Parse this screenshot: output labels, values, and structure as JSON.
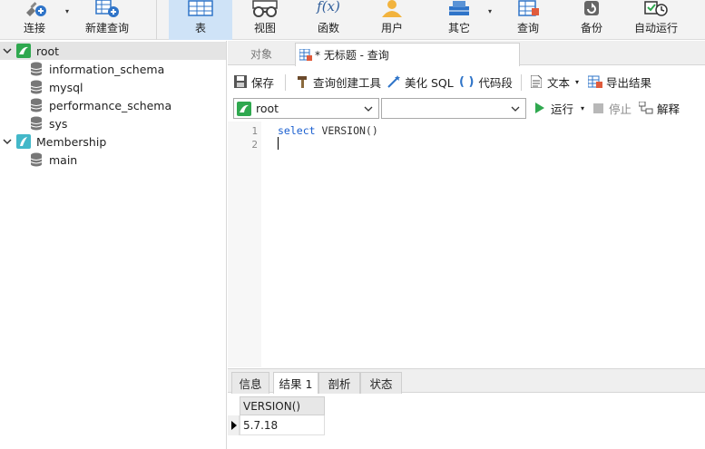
{
  "toolbar": {
    "connect": "连接",
    "new_query": "新建查询",
    "table": "表",
    "view": "视图",
    "function": "函数",
    "function_glyph": "f(x)",
    "user": "用户",
    "other": "其它",
    "query": "查询",
    "backup": "备份",
    "auto_run": "自动运行"
  },
  "sidebar": {
    "connections": [
      {
        "name": "root",
        "databases": [
          "information_schema",
          "mysql",
          "performance_schema",
          "sys"
        ]
      },
      {
        "name": "Membership",
        "databases": [
          "main"
        ]
      }
    ]
  },
  "tabs": {
    "objects": "对象",
    "query_tab": "* 无标题 - 查询"
  },
  "query_toolbar": {
    "save": "保存",
    "query_builder": "查询创建工具",
    "beautify": "美化 SQL",
    "code_snippet": "代码段",
    "code_snippet_glyph": "( )",
    "text": "文本",
    "export": "导出结果"
  },
  "conn_row": {
    "connection": "root",
    "database": "",
    "run": "运行",
    "stop": "停止",
    "explain": "解释"
  },
  "editor": {
    "line_numbers": [
      "1",
      "2"
    ],
    "keyword": "select",
    "rest": " VERSION()"
  },
  "result_tabs": {
    "info": "信息",
    "result1": "结果 1",
    "profile": "剖析",
    "status": "状态"
  },
  "result_grid": {
    "columns": [
      "VERSION()"
    ],
    "rows": [
      [
        "5.7.18"
      ]
    ]
  },
  "colors": {
    "accent": "#1a5fd0",
    "mysql_green": "#2fa84f",
    "toolbar_active": "#cfe3f7"
  }
}
